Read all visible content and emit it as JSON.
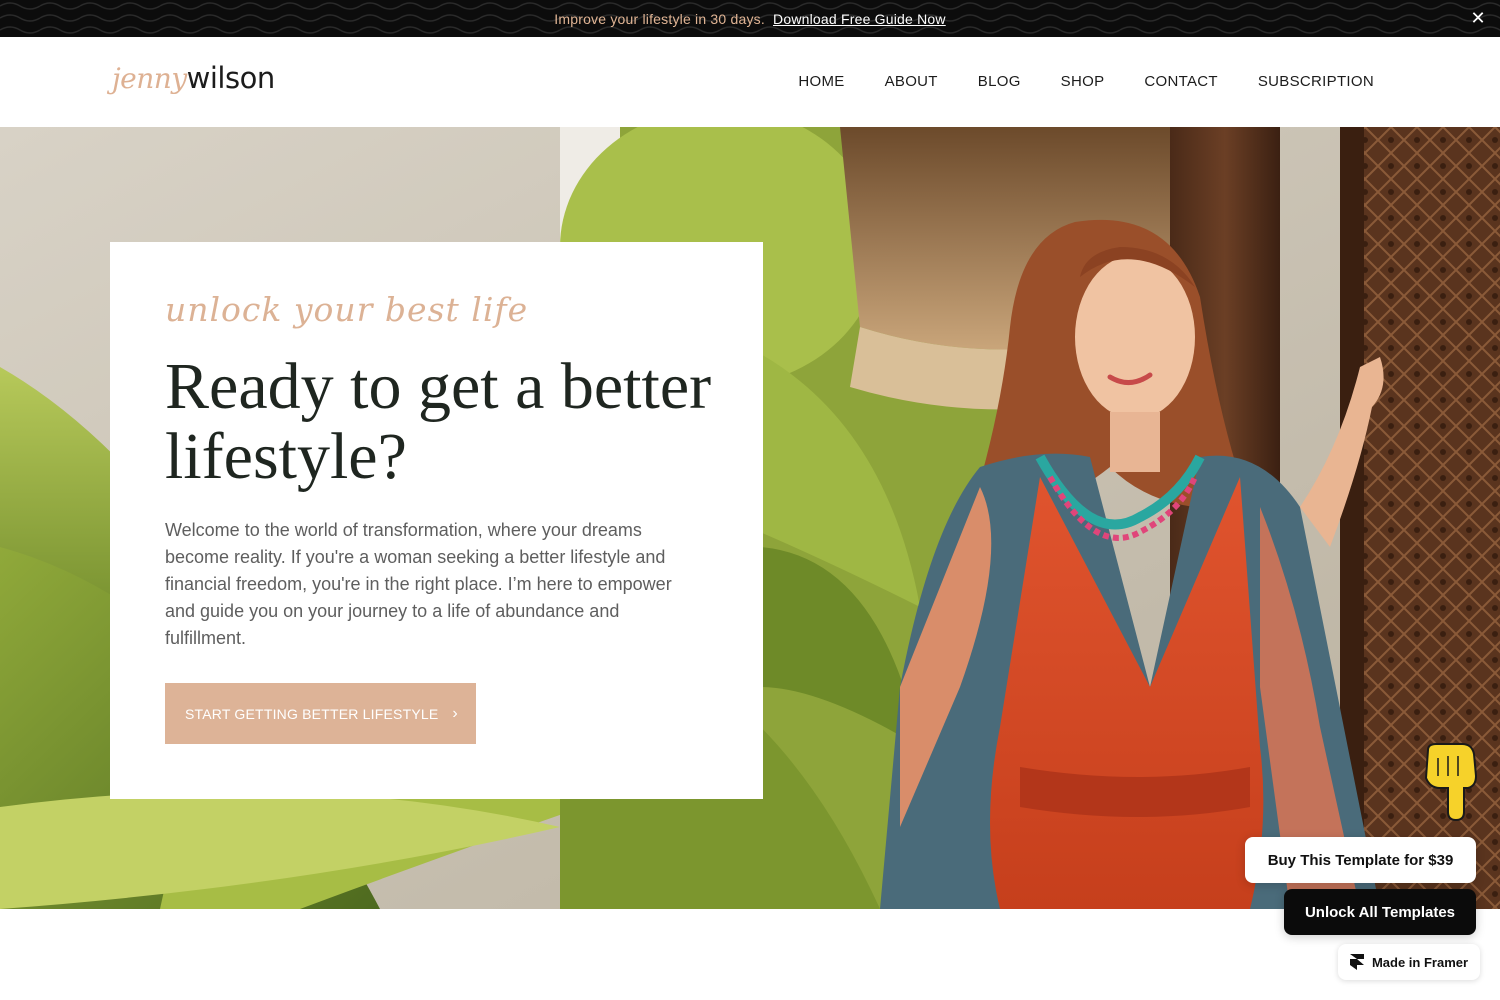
{
  "announcement": {
    "lead_text": "Improve your lifestyle in 30 days.",
    "link_text": "Download Free Guide Now",
    "close_icon": "close-icon",
    "lead_color": "#e0b494"
  },
  "header": {
    "logo_first": "jenny",
    "logo_last": "wilson",
    "nav": [
      "HOME",
      "ABOUT",
      "BLOG",
      "SHOP",
      "CONTACT",
      "SUBSCRIPTION"
    ]
  },
  "hero": {
    "tagline": "unlock your best life",
    "heading": "Ready to get a better lifestyle?",
    "body": "Welcome to the world of transformation, where your dreams become reality. If you're a woman seeking a better lifestyle and financial freedom, you're in the right place. I’m here to empower and guide you on your journey to a life of abundance and fulfillment.",
    "cta_label": "START GETTING BETTER LIFESTYLE",
    "cta_icon": "chevron-right-icon",
    "accent_color": "#ddb397"
  },
  "widgets": {
    "pointer_icon": "pointing-hand-icon",
    "buy_label": "Buy This Template for $39",
    "unlock_label": "Unlock All Templates",
    "framer_label": "Made in Framer",
    "framer_icon": "framer-logo-icon"
  }
}
